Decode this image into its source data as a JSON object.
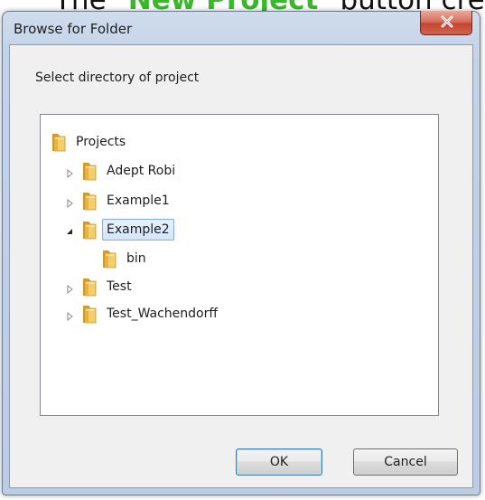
{
  "background_text": {
    "prefix": "The \"",
    "highlight": "New Project",
    "suffix": "\" button creates a"
  },
  "window": {
    "title": "Browse for Folder",
    "close_icon": "close-icon"
  },
  "dialog": {
    "prompt": "Select directory of project"
  },
  "tree": {
    "nodes": [
      {
        "label": "Projects",
        "icon": "folder-icon",
        "expander": "none",
        "level": 0
      },
      {
        "label": "Adept Robi",
        "icon": "folder-icon",
        "expander": "collapsed",
        "level": 1
      },
      {
        "label": "Example1",
        "icon": "folder-icon",
        "expander": "collapsed",
        "level": 1
      },
      {
        "label": "Example2",
        "icon": "folder-icon",
        "expander": "expanded",
        "level": 1,
        "selected": true
      },
      {
        "label": "bin",
        "icon": "folder-icon",
        "expander": "none",
        "level": 2
      },
      {
        "label": "Test",
        "icon": "folder-icon",
        "expander": "collapsed",
        "level": 1
      },
      {
        "label": "Test_Wachendorff",
        "icon": "folder-icon",
        "expander": "collapsed",
        "level": 1
      }
    ]
  },
  "buttons": {
    "ok": "OK",
    "cancel": "Cancel"
  },
  "colors": {
    "highlight_text": "#3bb82c",
    "folder": "#e8b84a",
    "selection_border": "#84acdd",
    "close_button": "#c24632"
  }
}
